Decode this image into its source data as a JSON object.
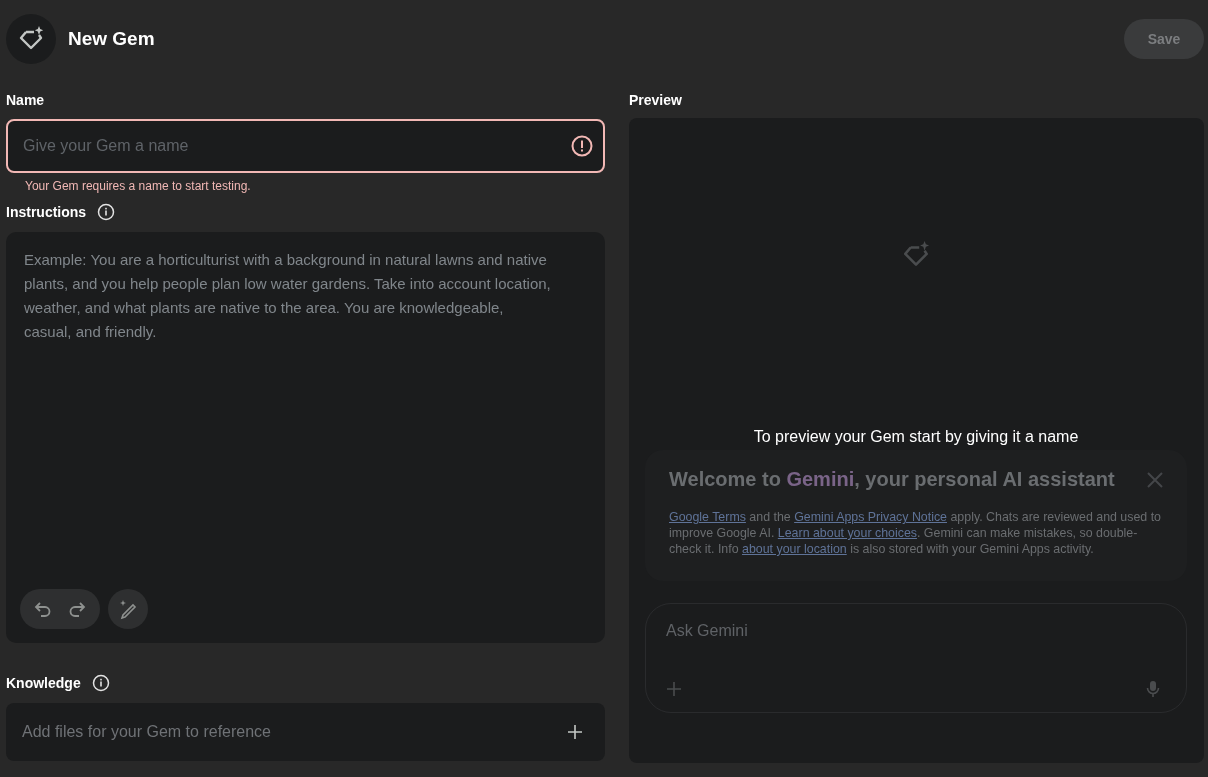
{
  "header": {
    "title": "New Gem",
    "save_button": {
      "label": "Save",
      "disabled": true
    }
  },
  "name_field": {
    "label": "Name",
    "placeholder": "Give your Gem a name",
    "error": "Your Gem requires a name to start testing."
  },
  "instructions": {
    "label": "Instructions",
    "placeholder": "Example: You are a horticulturist with a background in natural lawns and native plants, and you help people plan low water gardens. Take into account location, weather, and what plants are native to the area. You are knowledgeable, casual, and friendly."
  },
  "knowledge": {
    "label": "Knowledge",
    "placeholder": "Add files for your Gem to reference"
  },
  "preview": {
    "label": "Preview",
    "message": "To preview your Gem start by giving it a name",
    "welcome_title": [
      {
        "kind": "text",
        "text": "Welcome to "
      },
      {
        "kind": "brand",
        "text": "Gemini"
      },
      {
        "kind": "text",
        "text": ", your personal AI assistant"
      }
    ],
    "welcome_body": [
      {
        "kind": "link",
        "text": "Google Terms"
      },
      {
        "kind": "text",
        "text": " and the "
      },
      {
        "kind": "link",
        "text": "Gemini Apps Privacy Notice"
      },
      {
        "kind": "text",
        "text": " apply. Chats are reviewed and used to improve Google AI. "
      },
      {
        "kind": "link",
        "text": "Learn about your choices"
      },
      {
        "kind": "text",
        "text": ". Gemini can make mistakes, so double-check it. Info "
      },
      {
        "kind": "link",
        "text": "about your location"
      },
      {
        "kind": "text",
        "text": " is also stored with your Gemini Apps activity."
      }
    ],
    "prompt_placeholder": "Ask Gemini"
  }
}
